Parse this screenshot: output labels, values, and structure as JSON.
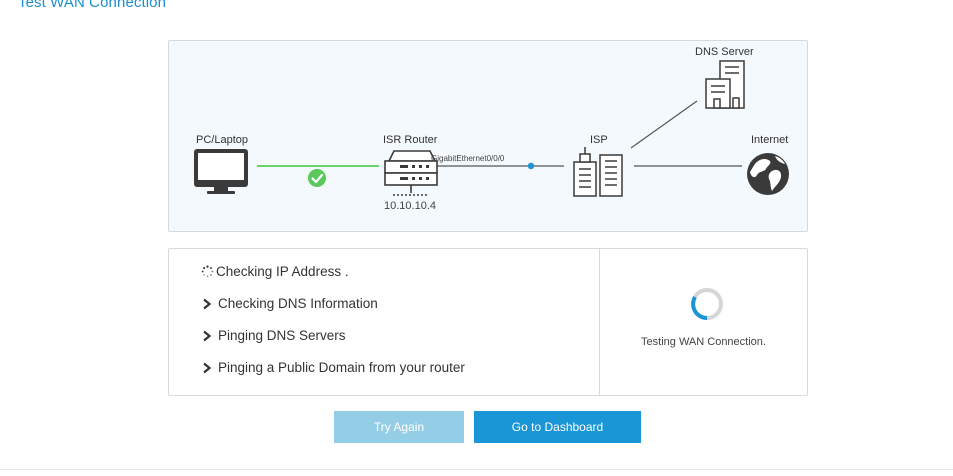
{
  "page": {
    "title": "Test WAN Connection"
  },
  "topology": {
    "pc_label": "PC/Laptop",
    "router_label": "ISR Router",
    "router_ip": "10.10.10.4",
    "interface_label": "GigabitEthernet0/0/0",
    "isp_label": "ISP",
    "dns_label": "DNS Server",
    "internet_label": "Internet",
    "pc_link_status": "connected"
  },
  "steps": [
    {
      "label": "Checking IP Address .",
      "state": "in-progress"
    },
    {
      "label": "Checking DNS Information",
      "state": "pending"
    },
    {
      "label": "Pinging DNS Servers",
      "state": "pending"
    },
    {
      "label": "Pinging a Public Domain from your router",
      "state": "pending"
    }
  ],
  "status": {
    "text": "Testing WAN Connection.",
    "spinner": "loading-spinner-icon"
  },
  "buttons": {
    "try_again": "Try Again",
    "go_dashboard": "Go to Dashboard"
  },
  "colors": {
    "accent": "#1a95d6",
    "accent_disabled": "#94cde6",
    "link_ok": "#6ad36a",
    "check_ok": "#5cc85c",
    "icon_dark": "#3a3a3a",
    "panel_bg": "#f3f9fd"
  }
}
